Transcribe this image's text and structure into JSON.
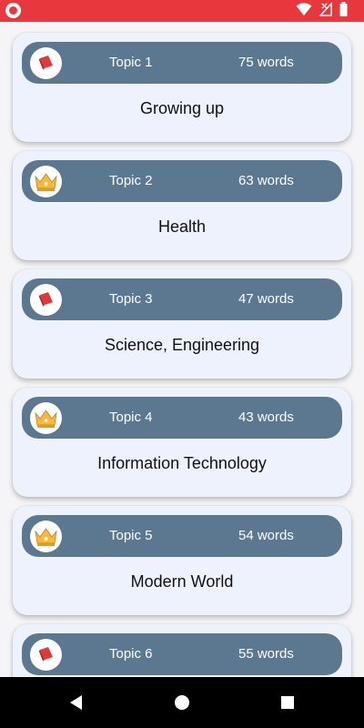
{
  "status_bar": {
    "app_icon": "app-notification-icon",
    "icons": [
      "wifi-icon",
      "no-signal-icon",
      "battery-icon"
    ],
    "time": ""
  },
  "topics": [
    {
      "label": "Topic 1",
      "count": "75 words",
      "title": "Growing up",
      "icon": "book-icon"
    },
    {
      "label": "Topic 2",
      "count": "63 words",
      "title": "Health",
      "icon": "crown-icon"
    },
    {
      "label": "Topic 3",
      "count": "47 words",
      "title": "Science, Engineering",
      "icon": "book-icon"
    },
    {
      "label": "Topic 4",
      "count": "43 words",
      "title": "Information Technology",
      "icon": "crown-icon"
    },
    {
      "label": "Topic 5",
      "count": "54 words",
      "title": "Modern World",
      "icon": "crown-icon"
    },
    {
      "label": "Topic 6",
      "count": "55 words",
      "title": "",
      "icon": "book-icon"
    }
  ],
  "nav_bar": {
    "back": "back-icon",
    "home": "home-icon",
    "recents": "recents-icon"
  },
  "colors": {
    "status_bar": "#e8383d",
    "topic_bar": "#5b7890",
    "card_bg": "#edf2fc",
    "crown": "#f6b93b",
    "book": "#e0393c"
  }
}
